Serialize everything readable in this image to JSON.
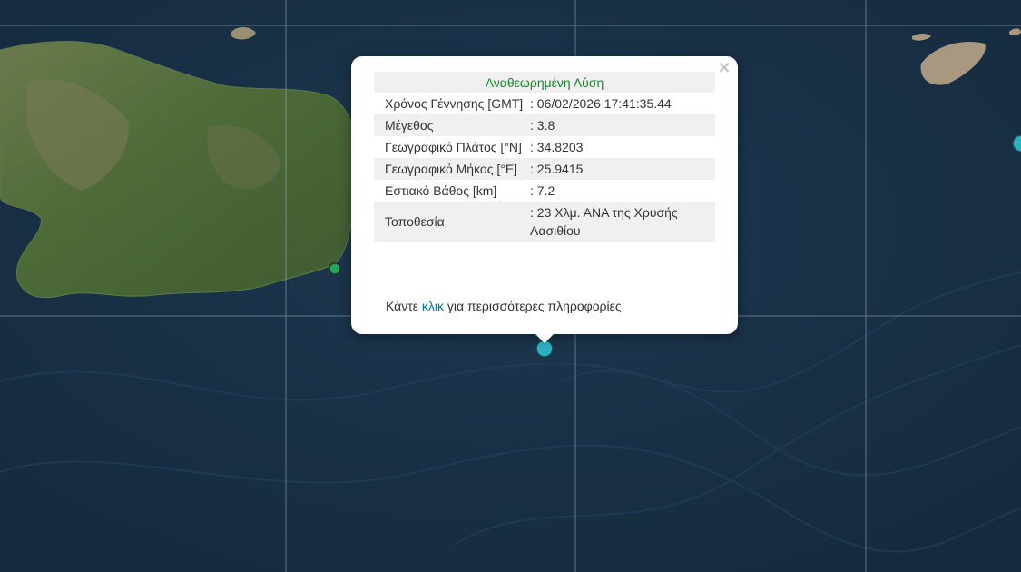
{
  "popup": {
    "header": "Αναθεωρημένη Λύση",
    "close_label": "×",
    "rows": [
      {
        "label": "Χρόνος Γέννησης [GMT]",
        "value": "06/02/2026 17:41:35.44"
      },
      {
        "label": "Μέγεθος",
        "value": "3.8"
      },
      {
        "label": "Γεωγραφικό Πλάτος [°N]",
        "value": "34.8203"
      },
      {
        "label": "Γεωγραφικό Μήκος [°E]",
        "value": "25.9415"
      },
      {
        "label": "Εστιακό Βάθος [km]",
        "value": "7.2"
      },
      {
        "label": "Τοποθεσία",
        "value": "23 Χλμ. ΑΝΑ της Χρυσής Λασιθίου"
      }
    ],
    "more_prefix": "Κάντε ",
    "more_link": "κλικ",
    "more_suffix": " για περισσότερες πληροφορίες"
  },
  "map": {
    "sea_color": "#1a3248",
    "land_color": "#4f6b38",
    "marker_selected_color": "#2bb0c2",
    "marker_other_color": "#27a35a",
    "icons": [
      "close-icon",
      "earthquake-marker"
    ]
  }
}
